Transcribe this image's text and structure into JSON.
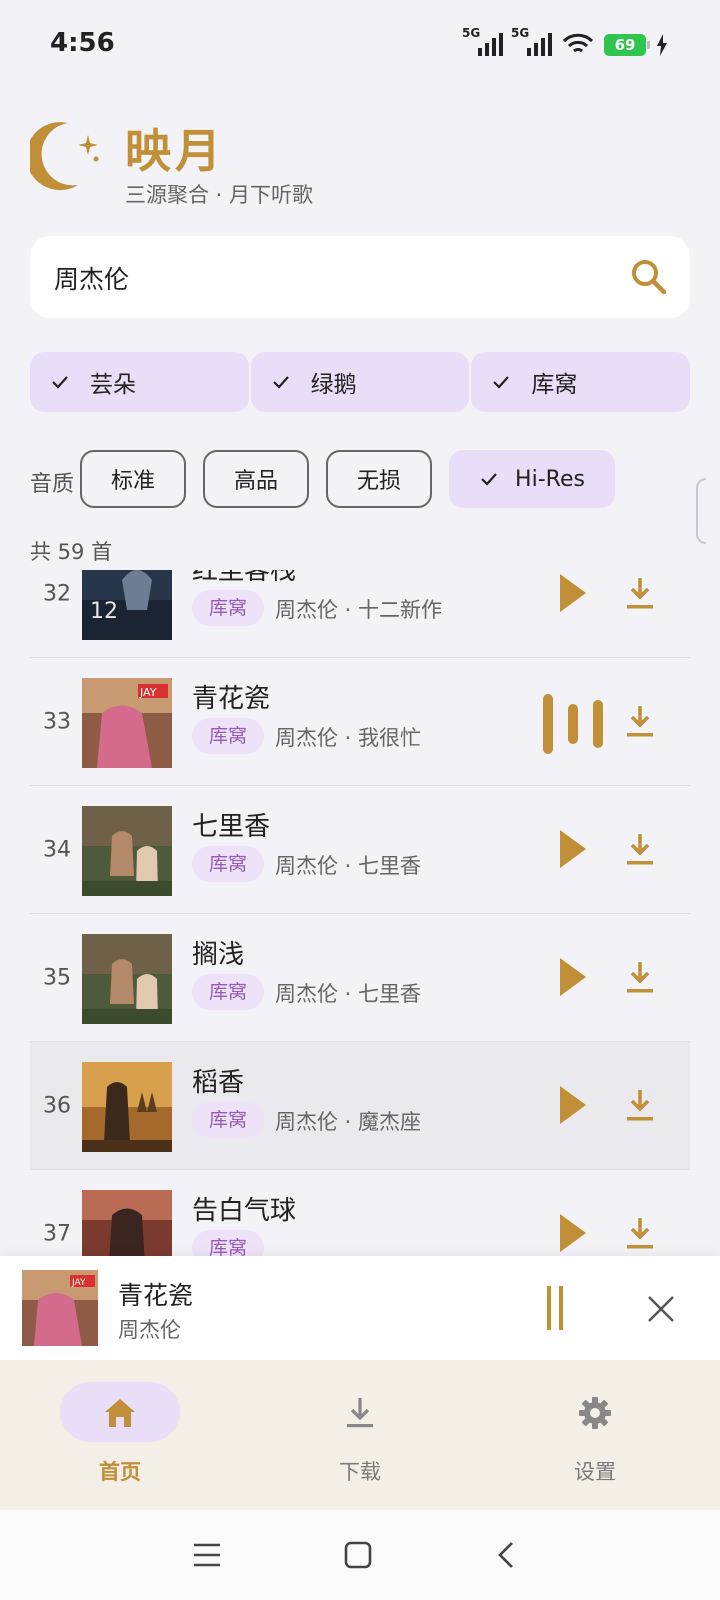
{
  "status": {
    "time": "4:56",
    "signal1": "5G",
    "signal2": "5G",
    "battery": "69"
  },
  "brand": {
    "name": "映月",
    "subtitle": "三源聚合 · 月下听歌"
  },
  "search": {
    "value": "周杰伦"
  },
  "sources": [
    {
      "label": "芸朵",
      "selected": true
    },
    {
      "label": "绿鹅",
      "selected": true
    },
    {
      "label": "库窝",
      "selected": true
    }
  ],
  "quality": {
    "label": "音质",
    "options": [
      "标准",
      "高品",
      "无损",
      "Hi-Res"
    ],
    "selected": "Hi-Res"
  },
  "count_text": "共 59 首",
  "songs": [
    {
      "num": "32",
      "title": "红尘客栈",
      "source": "库窝",
      "artist": "周杰伦",
      "album": "十二新作",
      "meta": "周杰伦 · 十二新作",
      "playing": false
    },
    {
      "num": "33",
      "title": "青花瓷",
      "source": "库窝",
      "artist": "周杰伦",
      "album": "我很忙",
      "meta": "周杰伦 · 我很忙",
      "playing": true
    },
    {
      "num": "34",
      "title": "七里香",
      "source": "库窝",
      "artist": "周杰伦",
      "album": "七里香",
      "meta": "周杰伦 · 七里香",
      "playing": false
    },
    {
      "num": "35",
      "title": "搁浅",
      "source": "库窝",
      "artist": "周杰伦",
      "album": "七里香",
      "meta": "周杰伦 · 七里香",
      "playing": false
    },
    {
      "num": "36",
      "title": "稻香",
      "source": "库窝",
      "artist": "周杰伦",
      "album": "魔杰座",
      "meta": "周杰伦 · 魔杰座",
      "playing": false
    },
    {
      "num": "37",
      "title": "告白气球",
      "source": "库窝",
      "artist": "周杰伦",
      "album": "",
      "meta": "",
      "playing": false
    }
  ],
  "mini_player": {
    "title": "青花瓷",
    "artist": "周杰伦"
  },
  "nav": [
    {
      "label": "首页",
      "icon": "home-icon",
      "active": true
    },
    {
      "label": "下载",
      "icon": "download-icon",
      "active": false
    },
    {
      "label": "设置",
      "icon": "gear-icon",
      "active": false
    }
  ],
  "colors": {
    "accent": "#c08f37",
    "chip": "#e9def7",
    "tag_text": "#9a5ab8",
    "background": "#f2f2f7"
  }
}
